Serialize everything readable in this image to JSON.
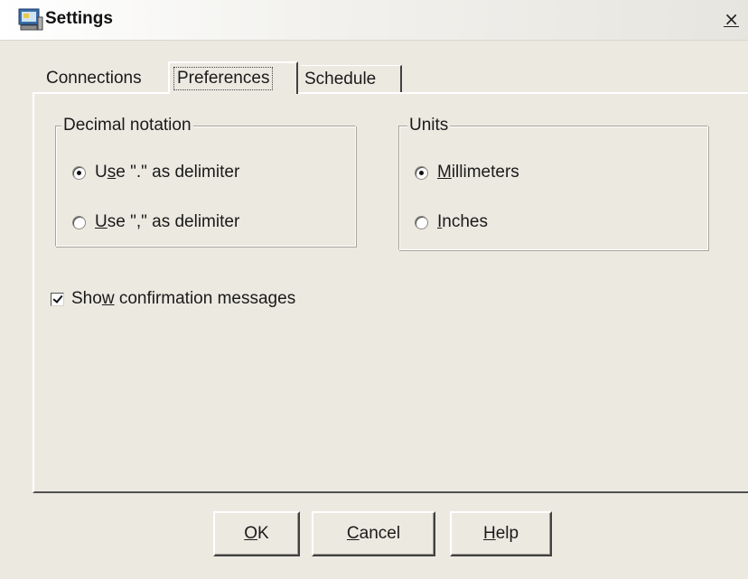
{
  "window": {
    "title": "Settings",
    "close_glyph": "×"
  },
  "tabs": [
    {
      "label": "Connections",
      "selected": false
    },
    {
      "label": "Preferences",
      "selected": true
    },
    {
      "label": "Schedule",
      "selected": false
    }
  ],
  "decimal_notation": {
    "legend": "Decimal notation",
    "options": [
      {
        "pre": "U",
        "mnemonic": "s",
        "post": "e \".\" as delimiter",
        "checked": true
      },
      {
        "pre": "",
        "mnemonic": "U",
        "post": "se \",\" as delimiter",
        "checked": false
      }
    ]
  },
  "units": {
    "legend": "Units",
    "options": [
      {
        "pre": "",
        "mnemonic": "M",
        "post": "illimeters",
        "checked": true
      },
      {
        "pre": "",
        "mnemonic": "I",
        "post": "nches",
        "checked": false
      }
    ]
  },
  "show_confirmation": {
    "pre": "Sho",
    "mnemonic": "w",
    "post": " confirmation messages",
    "checked": true
  },
  "buttons": {
    "ok": {
      "pre": "",
      "mnemonic": "O",
      "post": "K"
    },
    "cancel": {
      "pre": "",
      "mnemonic": "C",
      "post": "ancel"
    },
    "help": {
      "pre": "",
      "mnemonic": "H",
      "post": "elp"
    }
  },
  "icons": {
    "app": "settings-app-icon",
    "close": "close-icon"
  },
  "colors": {
    "window_bg": "#ece9e1",
    "title_text": "#111111"
  }
}
